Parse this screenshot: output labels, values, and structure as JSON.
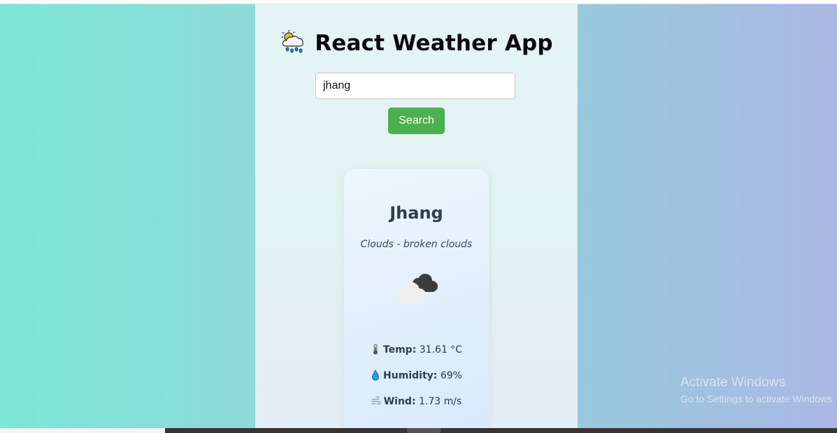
{
  "app": {
    "title": "React Weather App",
    "title_icon": "sun-cloud-rain-icon"
  },
  "search": {
    "value": "jhang",
    "button_label": "Search"
  },
  "weather": {
    "city": "Jhang",
    "description": "Clouds - broken clouds",
    "condition_icon": "broken-clouds-icon",
    "temp_label": "Temp:",
    "temp_value": "31.61 °C",
    "humidity_label": "Humidity:",
    "humidity_value": "69%",
    "wind_label": "Wind:",
    "wind_value": "1.73 m/s"
  },
  "watermark": {
    "title": "Activate Windows",
    "subtitle": "Go to Settings to activate Windows."
  },
  "colors": {
    "search_button": "#4caf50",
    "background_left": "#7de6d6",
    "background_right": "#abb8e3",
    "city_text": "#2c3e50"
  }
}
